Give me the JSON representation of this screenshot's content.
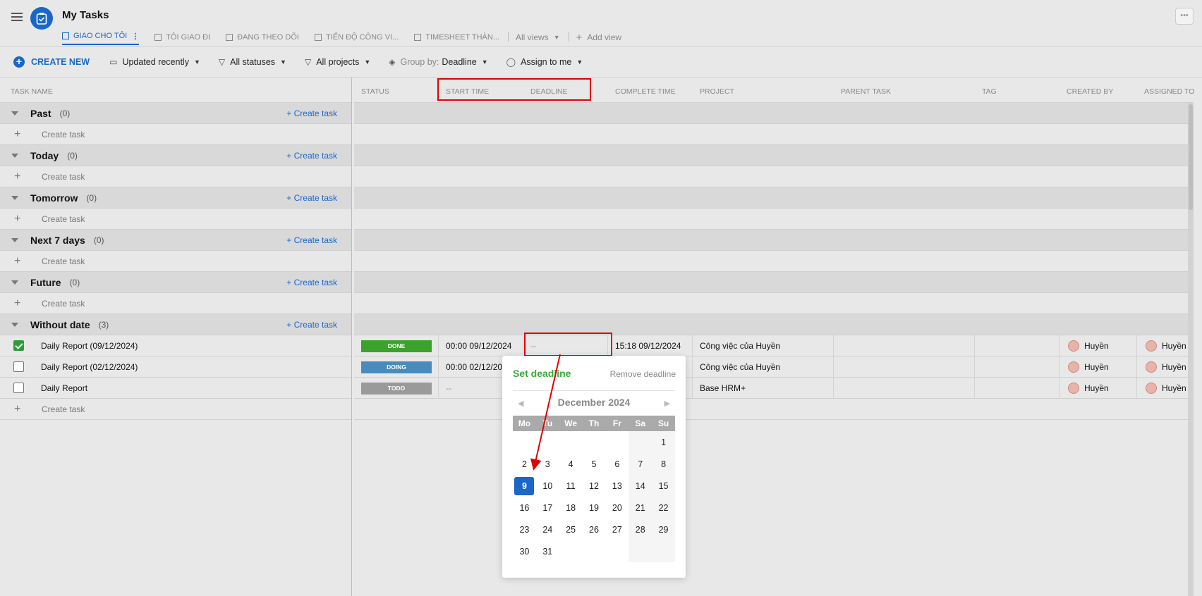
{
  "header": {
    "title": "My Tasks",
    "tabs": [
      {
        "label": "GIAO CHO TÔI",
        "active": true
      },
      {
        "label": "TÔI GIAO ĐI"
      },
      {
        "label": "ĐANG THEO DÕI"
      },
      {
        "label": "TIẾN ĐỘ CÔNG VI..."
      },
      {
        "label": "TIMESHEET THÀN..."
      }
    ],
    "all_views": "All views",
    "add_view": "Add view",
    "more": "•••"
  },
  "toolbar": {
    "create_new": "CREATE NEW",
    "sort": "Updated recently",
    "status_filter": "All statuses",
    "project_filter": "All projects",
    "group_by_prefix": "Group by:",
    "group_by_value": "Deadline",
    "assign": "Assign to me"
  },
  "columns": {
    "task_name": "TASK NAME",
    "status": "STATUS",
    "start_time": "START TIME",
    "deadline": "DEADLINE",
    "complete_time": "COMPLETE TIME",
    "project": "PROJECT",
    "parent_task": "PARENT TASK",
    "tag": "TAG",
    "created_by": "CREATED BY",
    "assigned_to": "ASSIGNED TO"
  },
  "groups": [
    {
      "name": "Past",
      "count": "(0)"
    },
    {
      "name": "Today",
      "count": "(0)"
    },
    {
      "name": "Tomorrow",
      "count": "(0)"
    },
    {
      "name": "Next 7 days",
      "count": "(0)"
    },
    {
      "name": "Future",
      "count": "(0)"
    },
    {
      "name": "Without date",
      "count": "(3)"
    }
  ],
  "create_task_link": "+ Create task",
  "create_task_row": "Create task",
  "tasks": [
    {
      "name": "Daily Report (09/12/2024)",
      "checked": true,
      "status": "DONE",
      "status_color": "#3aa32a",
      "start": "00:00 09/12/2024",
      "deadline": "--",
      "complete": "15:18 09/12/2024",
      "project": "Công việc của Huyền",
      "created_by": "Huyền",
      "assigned_to": "Huyền"
    },
    {
      "name": "Daily Report (02/12/2024)",
      "checked": false,
      "status": "DOING",
      "status_color": "#4a8bbd",
      "start": "00:00 02/12/2024",
      "deadline": "",
      "complete": "",
      "project": "Công việc của Huyền",
      "created_by": "Huyền",
      "assigned_to": "Huyền"
    },
    {
      "name": "Daily Report",
      "checked": false,
      "status": "TODO",
      "status_color": "#9a9a9a",
      "start": "--",
      "deadline": "",
      "complete": "",
      "project": "Base HRM+",
      "created_by": "Huyền",
      "assigned_to": "Huyền"
    }
  ],
  "popup": {
    "title": "Set deadline",
    "remove": "Remove deadline",
    "month": "December 2024",
    "weekdays": [
      "Mo",
      "Tu",
      "We",
      "Th",
      "Fr",
      "Sa",
      "Su"
    ],
    "days": [
      "",
      "",
      "",
      "",
      "",
      "",
      "1",
      "2",
      "3",
      "4",
      "5",
      "6",
      "7",
      "8",
      "9",
      "10",
      "11",
      "12",
      "13",
      "14",
      "15",
      "16",
      "17",
      "18",
      "19",
      "20",
      "21",
      "22",
      "23",
      "24",
      "25",
      "26",
      "27",
      "28",
      "29",
      "30",
      "31",
      "",
      "",
      "",
      "",
      ""
    ],
    "selected_day": "9"
  },
  "colors": {
    "accent": "#1a66c9",
    "done": "#3aa32a",
    "doing": "#4a8bbd",
    "todo": "#9a9a9a",
    "annotation": "#e00000",
    "set_deadline": "#3aa83a"
  }
}
